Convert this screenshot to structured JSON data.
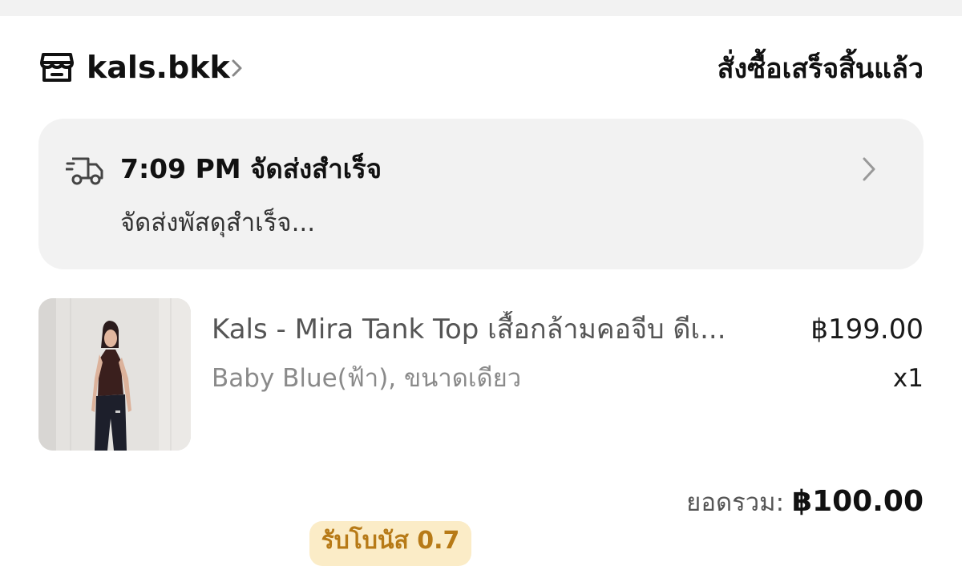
{
  "header": {
    "shop_icon": "store-icon",
    "shop_name": "kals.bkk",
    "chevron_icon": "chevron-right-icon",
    "order_status": "สั่งซื้อเสร็จสิ้นแล้ว"
  },
  "shipping": {
    "icon": "delivery-truck-icon",
    "title": "7:09 PM จัดส่งสำเร็จ",
    "subtitle": "จัดส่งพัสดุสำเร็จ...",
    "chevron_icon": "chevron-right-icon"
  },
  "product": {
    "name": "Kals - Mira Tank Top เสื้อกล้ามคอจีบ ดีเ...",
    "variant": "Baby Blue(ฟ้า), ขนาดเดียว",
    "price": "฿199.00",
    "quantity": "x1"
  },
  "summary": {
    "total_label": "ยอดรวม:",
    "total_value": "฿100.00",
    "bonus": "รับโบนัส 0.7"
  },
  "colors": {
    "card_background": "#f2f2f2",
    "bonus_background": "#fbecc7",
    "bonus_text": "#b77a17"
  }
}
